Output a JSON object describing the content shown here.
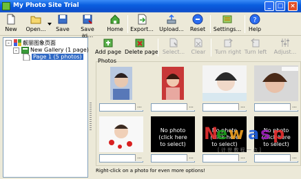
{
  "window": {
    "title": "My Photo Site Trial",
    "controls": [
      "_",
      "□",
      "×"
    ]
  },
  "toolbar": {
    "items": [
      {
        "label": "New",
        "icon": "new-page-icon"
      },
      {
        "label": "Open...",
        "icon": "open-folder-icon"
      },
      {
        "label": "Save",
        "icon": "save-disk-icon"
      },
      {
        "label": "Save as...",
        "icon": "save-as-icon"
      },
      {
        "label": "Home",
        "icon": "home-icon"
      },
      {
        "label": "Export...",
        "icon": "export-icon"
      },
      {
        "label": "Upload...",
        "icon": "upload-icon"
      },
      {
        "label": "Reset",
        "icon": "reset-icon"
      },
      {
        "label": "Settings...",
        "icon": "settings-icon"
      },
      {
        "label": "Help",
        "icon": "help-icon"
      }
    ]
  },
  "tree": {
    "root": {
      "label": "靓丽图象页面",
      "expander": "-"
    },
    "gallery": {
      "label": "New Gallery (1 page)",
      "expander": "-"
    },
    "page": {
      "label": "Page 1 (5 photos)"
    }
  },
  "page_toolbar": {
    "items": [
      {
        "label": "Add page",
        "enabled": true,
        "icon": "add-page-icon"
      },
      {
        "label": "Delete page",
        "enabled": true,
        "icon": "delete-page-icon"
      },
      {
        "label": "Select...",
        "enabled": false,
        "icon": "select-icon"
      },
      {
        "label": "Clear",
        "enabled": false,
        "icon": "clear-icon"
      },
      {
        "label": "Turn right",
        "enabled": false,
        "icon": "turn-right-icon"
      },
      {
        "label": "Turn left",
        "enabled": false,
        "icon": "turn-left-icon"
      },
      {
        "label": "Adjust...",
        "enabled": false,
        "icon": "adjust-icon"
      }
    ]
  },
  "photos": {
    "group_label": "Photos",
    "caption_button": "...",
    "no_photo_text": [
      "No photo",
      "(click here",
      "to select)"
    ],
    "cells": [
      {
        "has_photo": true,
        "caption": "",
        "icon": "portrait-photo-icon"
      },
      {
        "has_photo": true,
        "caption": "",
        "icon": "portrait-photo-icon"
      },
      {
        "has_photo": true,
        "caption": "",
        "icon": "portrait-photo-icon"
      },
      {
        "has_photo": true,
        "caption": "",
        "icon": "portrait-photo-icon"
      },
      {
        "has_photo": true,
        "caption": "",
        "icon": "portrait-photo-icon"
      },
      {
        "has_photo": false,
        "caption": ""
      },
      {
        "has_photo": false,
        "caption": ""
      },
      {
        "has_photo": false,
        "caption": ""
      }
    ]
  },
  "status_text": "Right-click on a photo for even more options!",
  "watermark": {
    "text": "Newasp",
    "sub": "[ 计 世 教 程 一 点 ]"
  },
  "colors": {
    "title_bar": "#0a4fd0",
    "selection": "#316ac5",
    "window_bg": "#ece9d8",
    "tree_border": "#7f9db9"
  }
}
